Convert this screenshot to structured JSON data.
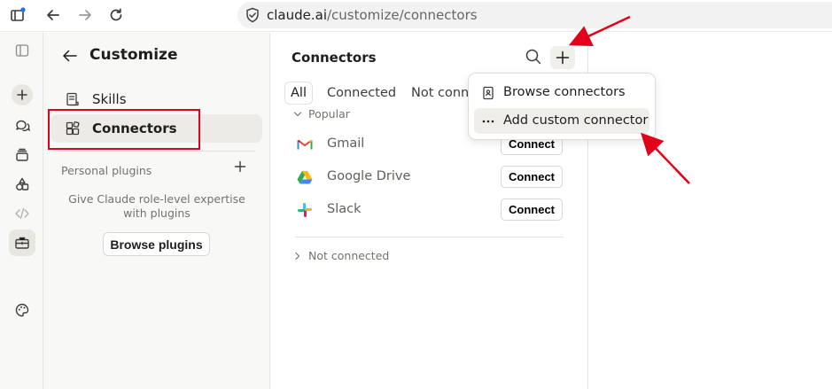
{
  "browser": {
    "url_domain": "claude.ai",
    "url_path": "/customize/connectors"
  },
  "sidebar": {
    "title": "Customize",
    "items": [
      {
        "label": "Skills"
      },
      {
        "label": "Connectors"
      }
    ],
    "personal_plugins_label": "Personal plugins",
    "plugins_description": "Give Claude role-level expertise with plugins",
    "browse_plugins_label": "Browse plugins"
  },
  "main": {
    "title": "Connectors",
    "tabs": [
      {
        "label": "All"
      },
      {
        "label": "Connected"
      },
      {
        "label": "Not conne"
      }
    ],
    "popular_label": "Popular",
    "not_connected_label": "Not connected",
    "connectors": [
      {
        "name": "Gmail",
        "button": "Connect",
        "icon": "gmail-logo"
      },
      {
        "name": "Google Drive",
        "button": "Connect",
        "icon": "google-drive-logo"
      },
      {
        "name": "Slack",
        "button": "Connect",
        "icon": "slack-logo"
      }
    ]
  },
  "dropdown": {
    "items": [
      {
        "label": "Browse connectors",
        "icon": "book-icon"
      },
      {
        "label": "Add custom connector",
        "icon": "more-dots-icon"
      }
    ]
  },
  "colors": {
    "highlight_box": "#e3001b",
    "annotation_arrow": "#e3001b",
    "accent_selected": "#ecebe7"
  }
}
